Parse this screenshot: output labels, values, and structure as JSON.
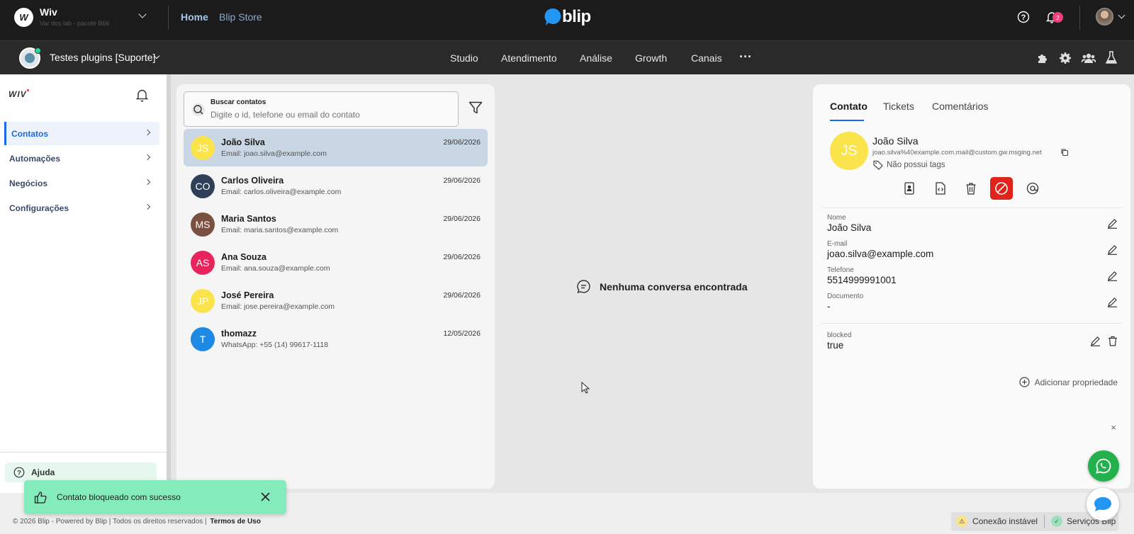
{
  "topbar": {
    "org_initial": "W",
    "org_name": "Wiv",
    "org_sub": "Var dos lab - pacote B66",
    "nav": [
      "Home",
      "Blip Store"
    ],
    "logo_text": "blip",
    "notif_count": "2"
  },
  "secbar": {
    "bot_name": "Testes plugins [Suporte]",
    "menu": [
      "Studio",
      "Atendimento",
      "Análise",
      "Growth",
      "Canais"
    ],
    "more": "···"
  },
  "sidebar": {
    "logo": "WIV",
    "items": [
      {
        "label": "Contatos",
        "active": true
      },
      {
        "label": "Automações"
      },
      {
        "label": "Negócios"
      },
      {
        "label": "Configurações"
      }
    ],
    "help": "Ajuda"
  },
  "search": {
    "label": "Buscar contatos",
    "placeholder": "Digite o id, telefone ou email do contato"
  },
  "contacts": [
    {
      "initials": "JS",
      "name": "João Silva",
      "sub": "Email: joao.silva@example.com",
      "date": "29/06/2026",
      "color": "#fbe34b",
      "text_color": "#fff",
      "selected": true
    },
    {
      "initials": "CO",
      "name": "Carlos Oliveira",
      "sub": "Email: carlos.oliveira@example.com",
      "date": "29/06/2026",
      "color": "#2f3f57",
      "text_color": "#fff"
    },
    {
      "initials": "MS",
      "name": "Maria Santos",
      "sub": "Email: maria.santos@example.com",
      "date": "29/06/2026",
      "color": "#7a5040",
      "text_color": "#fff"
    },
    {
      "initials": "AS",
      "name": "Ana Souza",
      "sub": "Email: ana.souza@example.com",
      "date": "29/06/2026",
      "color": "#e8245c",
      "text_color": "#fff"
    },
    {
      "initials": "JP",
      "name": "José Pereira",
      "sub": "Email: jose.pereira@example.com",
      "date": "29/06/2026",
      "color": "#fbe34b",
      "text_color": "#fff"
    },
    {
      "initials": "T",
      "name": "thomazz",
      "sub": "WhatsApp: +55 (14) 99617-1118",
      "date": "12/05/2026",
      "color": "#1e88e5",
      "text_color": "#fff"
    }
  ],
  "center": {
    "empty_message": "Nenhuma conversa encontrada"
  },
  "detail": {
    "tabs": [
      "Contato",
      "Tickets",
      "Comentários"
    ],
    "initials": "JS",
    "name": "João Silva",
    "identity": "joao.silva%40example.com.mail@custom.gw.msging.net",
    "tags": "Não possui tags",
    "fields": [
      {
        "label": "Nome",
        "value": "João Silva"
      },
      {
        "label": "E-mail",
        "value": "joao.silva@example.com"
      },
      {
        "label": "Telefone",
        "value": "5514999991001"
      },
      {
        "label": "Documento",
        "value": "-"
      }
    ],
    "extra": {
      "label": "blocked",
      "value": "true"
    },
    "add_property": "Adicionar propriedade",
    "close": "×"
  },
  "toast": {
    "message": "Contato bloqueado com sucesso"
  },
  "footer": {
    "copyright": "© 2026 Blip - Powered by Blip | Todos os direitos reservados |",
    "terms": "Termos de Uso",
    "status1": "Conexão instável",
    "status2": "Serviços Blip"
  }
}
